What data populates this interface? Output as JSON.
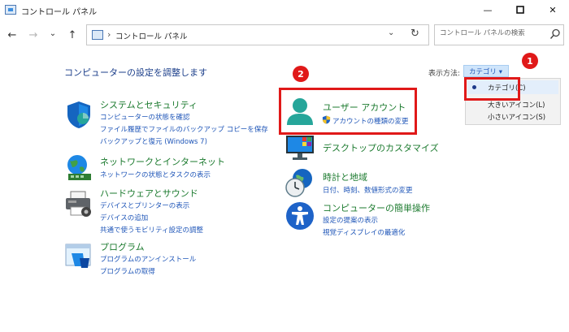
{
  "window": {
    "title": "コントロール パネル",
    "minimize_glyph": "—",
    "maximize_glyph": "□",
    "close_glyph": "✕"
  },
  "nav": {
    "back_glyph": "←",
    "forward_glyph": "→",
    "recent_glyph": "⌄",
    "up_glyph": "↑"
  },
  "address": {
    "separator": "›",
    "path": "コントロール パネル",
    "dropdown_glyph": "⌄",
    "refresh_glyph": "↻"
  },
  "search": {
    "placeholder": "コントロール パネルの検索"
  },
  "main": {
    "heading": "コンピューターの設定を調整します",
    "view_by_label": "表示方法:",
    "view_by_value": "カテゴリ ▾"
  },
  "view_menu": {
    "items": [
      "カテゴリ(C)",
      "大きいアイコン(L)",
      "小さいアイコン(S)"
    ],
    "selected": "カテゴリ(C)"
  },
  "annotations": {
    "badge1": "1",
    "badge2": "2"
  },
  "categories_left": [
    {
      "title": "システムとセキュリティ",
      "links": [
        "コンピューターの状態を確認",
        "ファイル履歴でファイルのバックアップ コピーを保存",
        "バックアップと復元 (Windows 7)"
      ]
    },
    {
      "title": "ネットワークとインターネット",
      "links": [
        "ネットワークの状態とタスクの表示"
      ]
    },
    {
      "title": "ハードウェアとサウンド",
      "links": [
        "デバイスとプリンターの表示",
        "デバイスの追加",
        "共通で使うモビリティ設定の調整"
      ]
    },
    {
      "title": "プログラム",
      "links": [
        "プログラムのアンインストール",
        "プログラムの取得"
      ]
    }
  ],
  "categories_right": [
    {
      "title": "ユーザー アカウント",
      "links": [
        "アカウントの種類の変更"
      ]
    },
    {
      "title": "デスクトップのカスタマイズ",
      "links": []
    },
    {
      "title": "時計と地域",
      "links": [
        "日付、時刻、数値形式の変更"
      ]
    },
    {
      "title": "コンピューターの簡単操作",
      "links": [
        "設定の提案の表示",
        "視覚ディスプレイの最適化"
      ]
    }
  ],
  "colors": {
    "link": "#1f56b8",
    "category_title": "#1b7a2e",
    "heading": "#1b3e8a",
    "annotation_red": "#e01919"
  }
}
